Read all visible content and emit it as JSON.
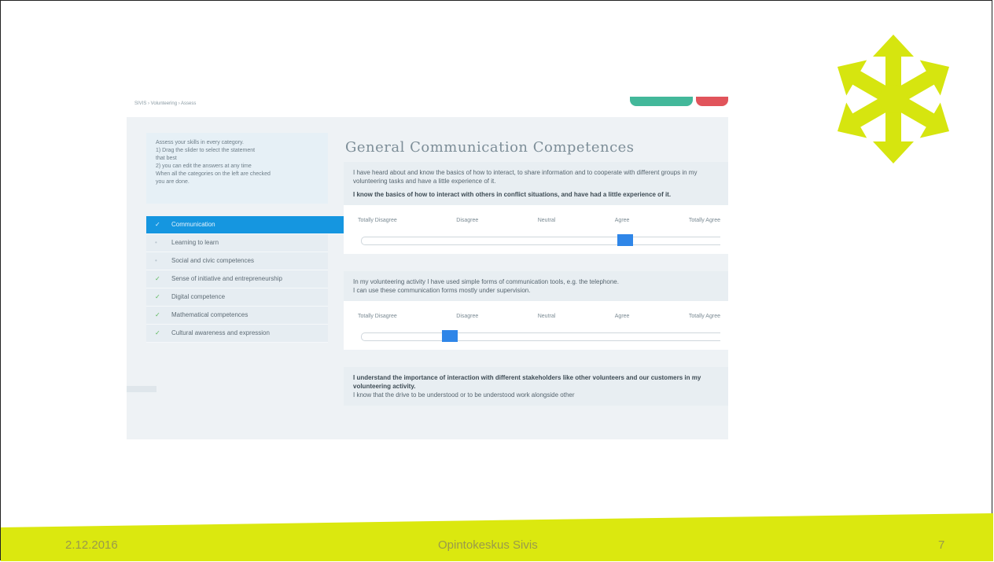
{
  "colors": {
    "accent": "#1596e0",
    "slider_thumb": "#2f86e8",
    "check": "#5cb85c",
    "footer": "#dbe80f"
  },
  "screenshot": {
    "breadcrumb": "SIVIS › Volunteering › Assess",
    "sidebar": {
      "instructions": [
        "Assess your skills in every category.",
        "1) Drag the slider to select the statement",
        "   that best",
        "2) you can edit the answers at any time",
        "When all the categories on the left are checked",
        "you are done."
      ],
      "items": [
        {
          "label": "Communication",
          "status": "done",
          "active": true
        },
        {
          "label": "Learning to learn",
          "status": "pending",
          "active": false
        },
        {
          "label": "Social and civic competences",
          "status": "pending",
          "active": false
        },
        {
          "label": "Sense of initiative and entrepreneurship",
          "status": "done",
          "active": false
        },
        {
          "label": "Digital competence",
          "status": "done",
          "active": false
        },
        {
          "label": "Mathematical competences",
          "status": "done",
          "active": false
        },
        {
          "label": "Cultural awareness and expression",
          "status": "done",
          "active": false
        }
      ],
      "check_icon": "✓",
      "pending_icon": "•"
    },
    "main": {
      "title": "General Communication Competences",
      "questions": [
        {
          "statements": [
            {
              "text": "I have heard about and know the basics of how to interact, to share information and to cooperate with different groups in my volunteering tasks and have a little experience of it.",
              "bold": false
            },
            {
              "text": "I know the basics of how to interact with others in conflict situations, and have had a little experience of it.",
              "bold": true
            }
          ],
          "selected": 3
        },
        {
          "statements": [
            {
              "text": "In my volunteering activity I have used simple forms of communication tools, e.g. the telephone.",
              "bold": false
            },
            {
              "text": "I can use these communication forms mostly under supervision.",
              "bold": false
            }
          ],
          "selected": 1
        },
        {
          "statements": [
            {
              "text": "I understand the importance of interaction with different stakeholders like other volunteers and our customers in my volunteering activity.",
              "bold": true
            },
            {
              "text": "I know that the drive to be understood or to be understood work alongside other",
              "bold": false
            }
          ],
          "selected": null
        }
      ],
      "scale": [
        "Totally Disagree",
        "Disagree",
        "Neutral",
        "Agree",
        "Totally Agree"
      ]
    }
  },
  "footer": {
    "date": "2.12.2016",
    "organization": "Opintokeskus Sivis",
    "page_number": "7"
  },
  "logo": {
    "name": "sivis-arrows-logo",
    "color": "#d6e50f"
  }
}
